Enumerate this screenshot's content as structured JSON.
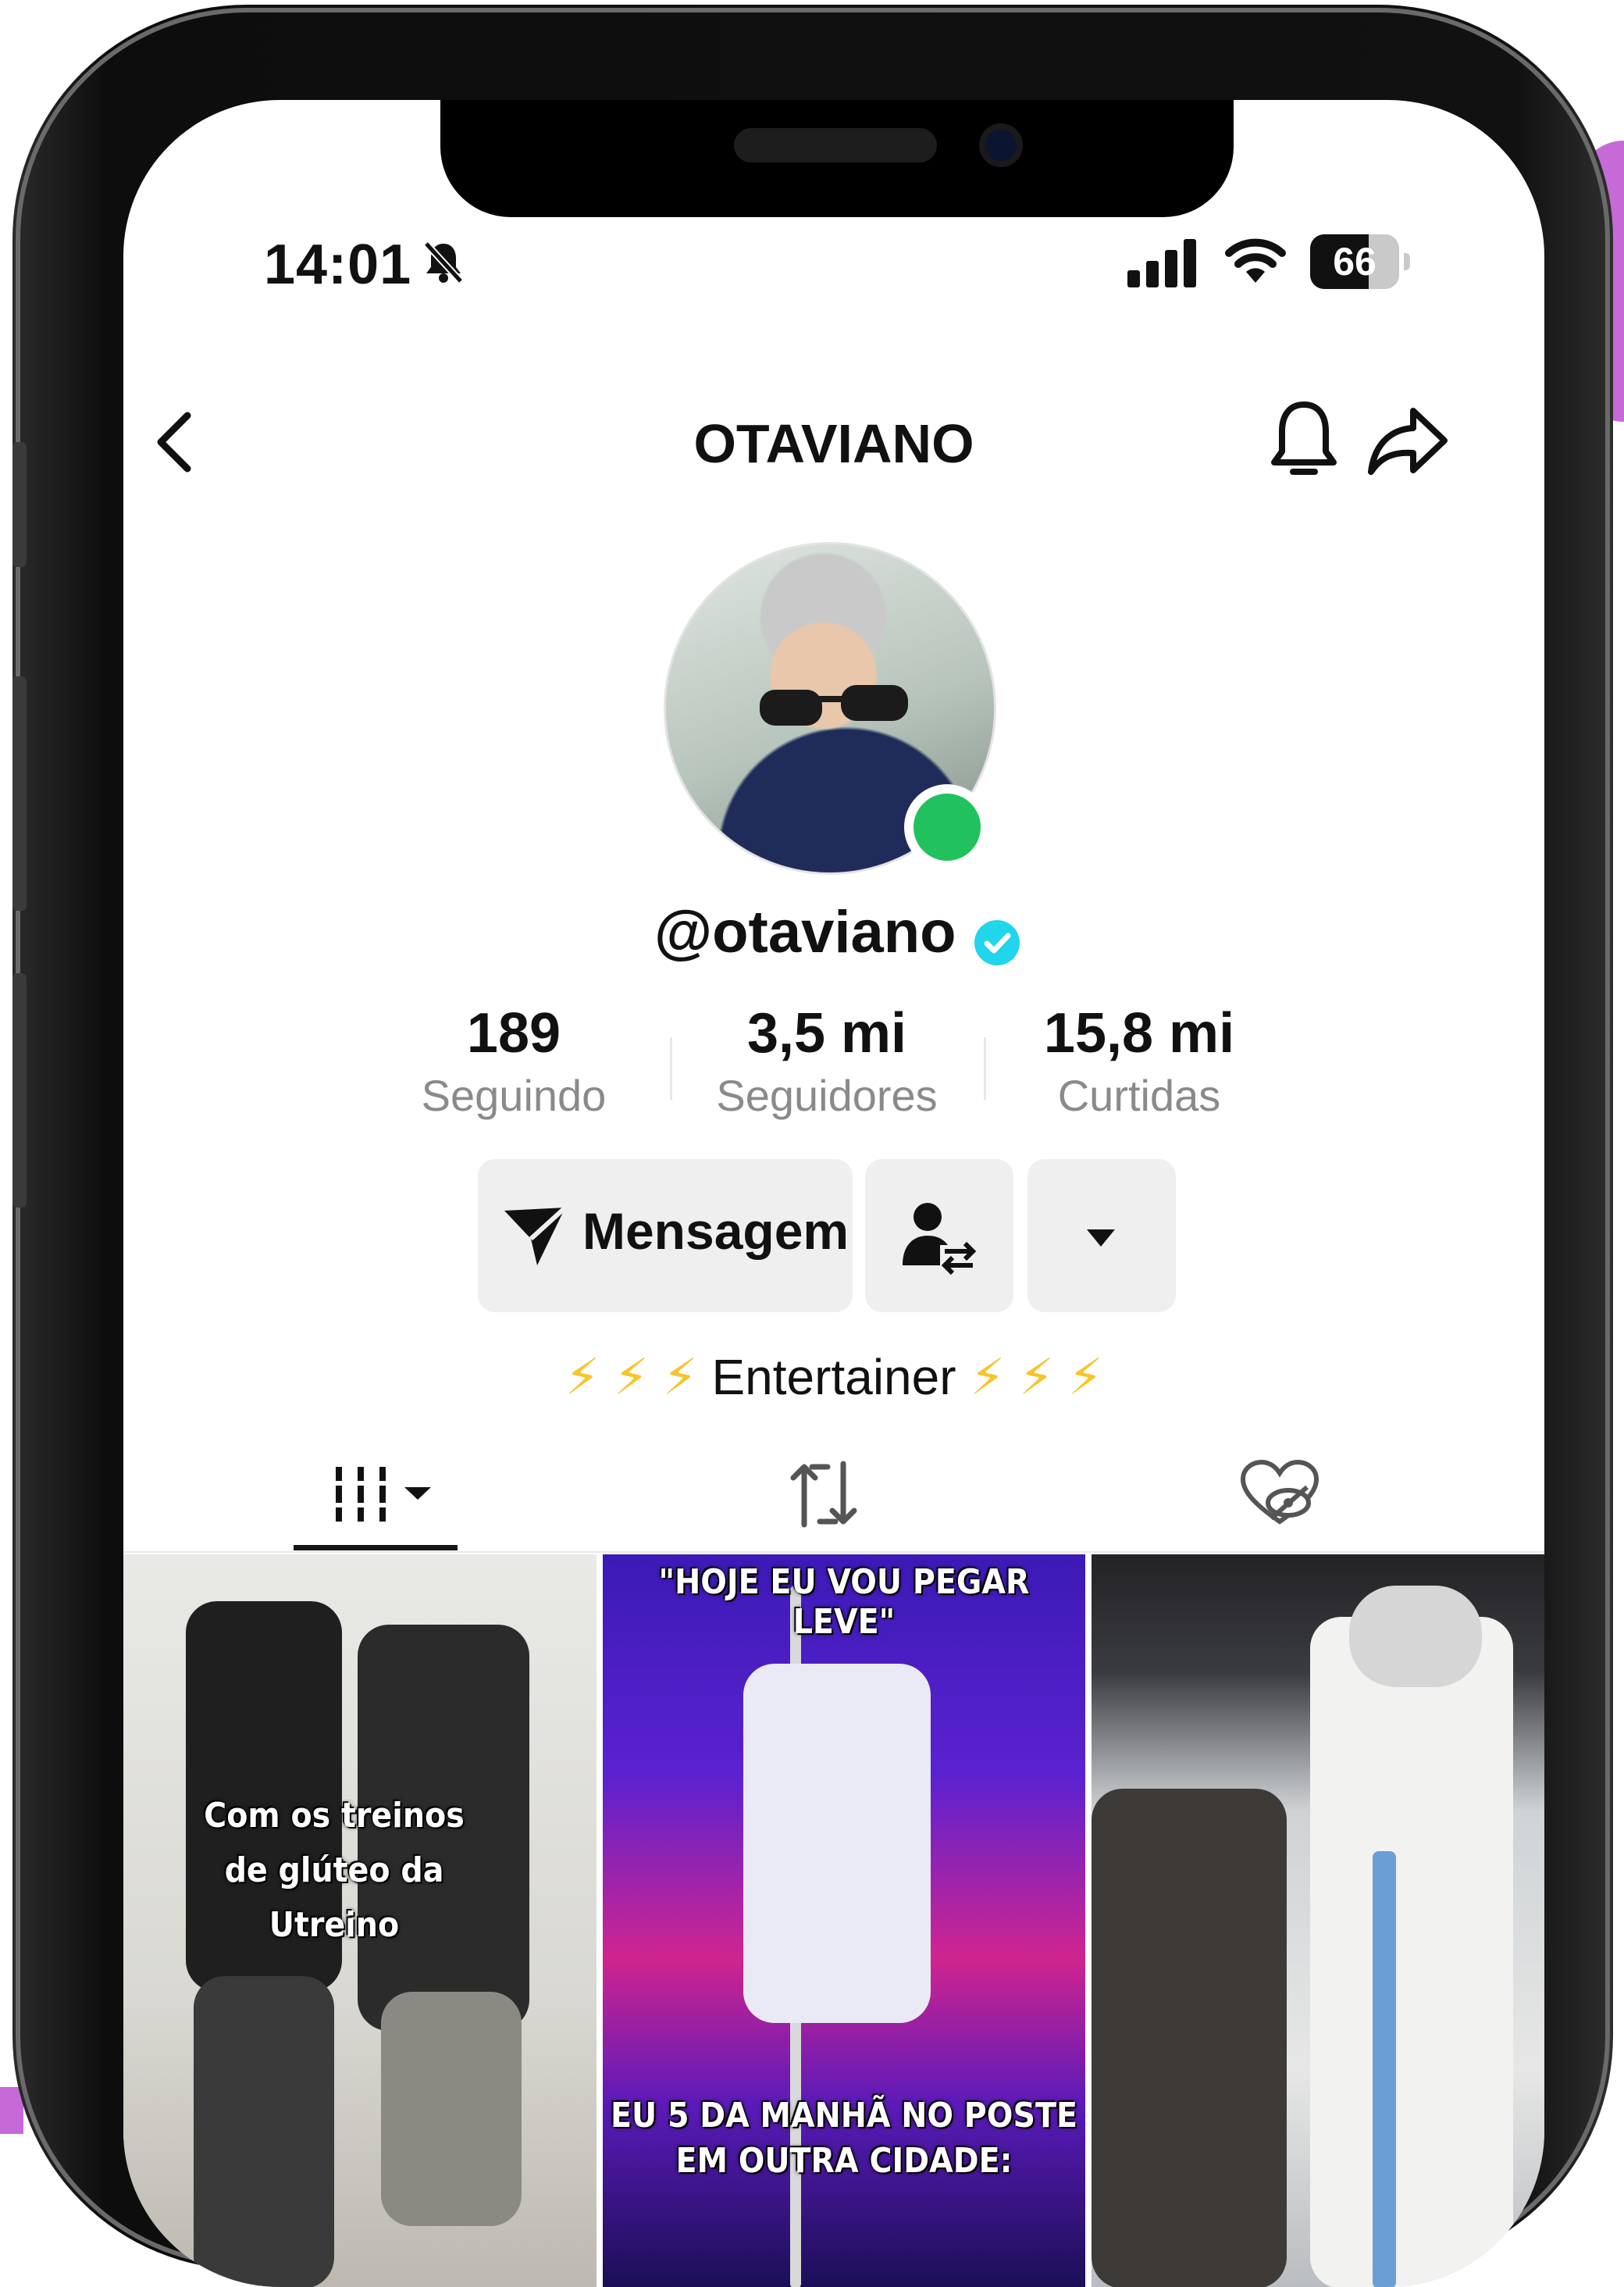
{
  "status_bar": {
    "time": "14:01",
    "battery_level": "66",
    "battery_fraction": 0.66,
    "icons": [
      "bell-slash-icon",
      "signal-icon",
      "wifi-icon",
      "battery-icon"
    ]
  },
  "header": {
    "title": "OTAVIANO",
    "icons": [
      "chevron-left-icon",
      "bell-icon",
      "share-icon"
    ]
  },
  "profile": {
    "username": "@otaviano",
    "verified": true,
    "online": true,
    "stats": [
      {
        "value": "189",
        "label": "Seguindo"
      },
      {
        "value": "3,5 mi",
        "label": "Seguidores"
      },
      {
        "value": "15,8 mi",
        "label": "Curtidas"
      }
    ],
    "buttons": {
      "message_label": "Mensagem",
      "message_icon": "send-icon",
      "friend_icon": "user-swap-icon",
      "more_icon": "caret-down-icon"
    },
    "bio": {
      "prefix": "⚡ ⚡ ⚡",
      "text": "Entertainer",
      "suffix": "⚡ ⚡ ⚡"
    }
  },
  "tabs": [
    {
      "name": "videos",
      "icon": "grid-bars-icon",
      "active": true
    },
    {
      "name": "reposts",
      "icon": "repost-icon",
      "active": false
    },
    {
      "name": "liked",
      "icon": "liked-hidden-icon",
      "active": false
    }
  ],
  "videos": [
    {
      "caption": "Com os treinos de glúteo da Utreino"
    },
    {
      "caption_top": "\"HOJE EU VOU PEGAR LEVE\"",
      "caption_bottom": "EU 5 DA MANHÃ NO POSTE EM OUTRA CIDADE:"
    },
    {
      "caption": ""
    }
  ],
  "colors": {
    "online": "#21c25e",
    "verified": "#20d5ec",
    "bolt": "#f7c52b",
    "text_primary": "#111111",
    "text_secondary": "#8a8a8a"
  }
}
